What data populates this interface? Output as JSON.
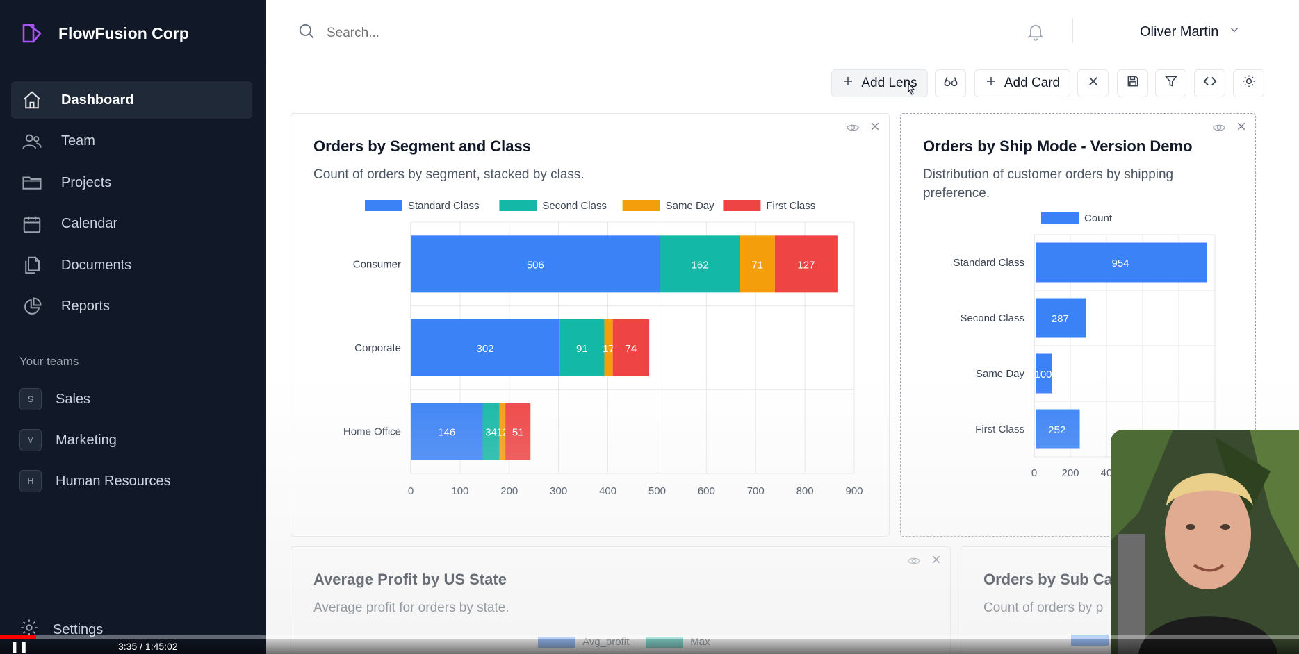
{
  "brand": {
    "name": "FlowFusion Corp"
  },
  "sidebar": {
    "nav": [
      {
        "label": "Dashboard",
        "icon": "home-icon",
        "active": true
      },
      {
        "label": "Team",
        "icon": "users-icon"
      },
      {
        "label": "Projects",
        "icon": "folder-icon"
      },
      {
        "label": "Calendar",
        "icon": "calendar-icon"
      },
      {
        "label": "Documents",
        "icon": "documents-icon"
      },
      {
        "label": "Reports",
        "icon": "pie-chart-icon"
      }
    ],
    "teams_title": "Your teams",
    "teams": [
      {
        "initial": "S",
        "label": "Sales"
      },
      {
        "initial": "M",
        "label": "Marketing"
      },
      {
        "initial": "H",
        "label": "Human Resources"
      }
    ],
    "settings_label": "Settings"
  },
  "topbar": {
    "search_placeholder": "Search...",
    "user_name": "Oliver Martin"
  },
  "toolbar": {
    "add_lens": "Add Lens",
    "add_card": "Add Card"
  },
  "colors": {
    "sidebar_bg": "#111827",
    "standard_class": "#3b82f6",
    "second_class": "#14b8a6",
    "same_day": "#f59e0b",
    "first_class": "#ef4444"
  },
  "cards": {
    "segment": {
      "title": "Orders by Segment and Class",
      "subtitle": "Count of orders by segment, stacked by class."
    },
    "shipmode": {
      "title": "Orders by Ship Mode - Version Demo",
      "subtitle": "Distribution of customer orders by shipping preference."
    },
    "profit": {
      "title": "Average Profit by US State",
      "subtitle": "Average profit for orders by state.",
      "legend": [
        "Avg_profit",
        "Max"
      ]
    },
    "subcat": {
      "title": "Orders by Sub Cate",
      "subtitle": "Count of orders by p"
    }
  },
  "chart_data": [
    {
      "type": "bar",
      "orientation": "horizontal",
      "stacked": true,
      "categories": [
        "Consumer",
        "Corporate",
        "Home Office"
      ],
      "series": [
        {
          "name": "Standard Class",
          "values": [
            506,
            302,
            146
          ]
        },
        {
          "name": "Second Class",
          "values": [
            162,
            91,
            34
          ]
        },
        {
          "name": "Same Day",
          "values": [
            71,
            17,
            12
          ]
        },
        {
          "name": "First Class",
          "values": [
            127,
            74,
            51
          ]
        }
      ],
      "xlim": [
        0,
        900
      ],
      "xticks": [
        0,
        100,
        200,
        300,
        400,
        500,
        600,
        700,
        800,
        900
      ],
      "legend": "top",
      "grid": true
    },
    {
      "type": "bar",
      "orientation": "horizontal",
      "categories": [
        "Standard Class",
        "Second Class",
        "Same Day",
        "First Class"
      ],
      "series": [
        {
          "name": "Count",
          "values": [
            954,
            287,
            100,
            252
          ]
        }
      ],
      "xlim": [
        0,
        1000
      ],
      "xticks_visible": [
        "0",
        "200",
        "40"
      ],
      "legend": "top",
      "grid": true
    }
  ],
  "video": {
    "time": "3:35 / 1:45:02"
  }
}
